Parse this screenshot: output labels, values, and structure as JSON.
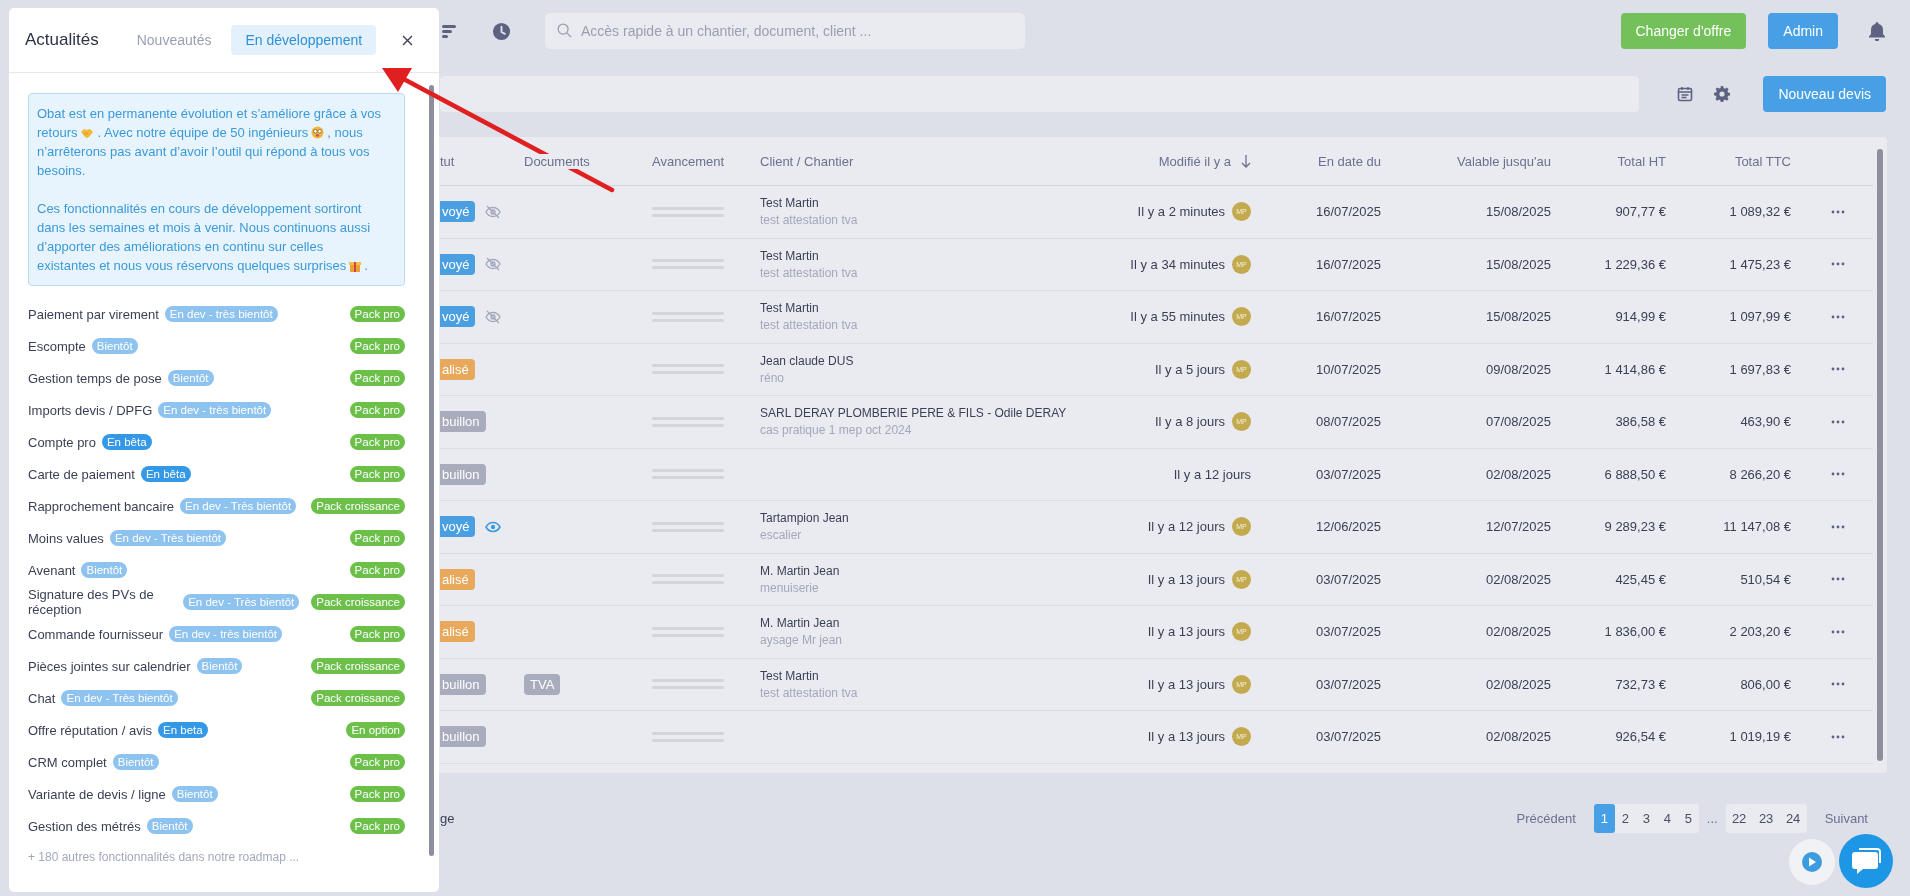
{
  "topbar": {
    "search": {
      "placeholder": "Accès rapide à un chantier, document, client ..."
    },
    "buttons": [
      {
        "label": "Changer d'offre",
        "kind": "upgrade"
      },
      {
        "label": "Admin",
        "kind": "primary"
      }
    ]
  },
  "toolbar": {
    "new_button": "Nouveau devis"
  },
  "table": {
    "columns": [
      "tut",
      "Documents",
      "Avancement",
      "Client / Chantier",
      "Modifié il y a",
      "En date du",
      "Valable jusqu'au",
      "Total HT",
      "Total TTC"
    ],
    "rows": [
      {
        "status": "voyé",
        "kind": "sent",
        "seen": false,
        "client": "Test Martin",
        "site": "test attestation tva",
        "modified": "Il y a 2 minutes",
        "avatar": "MP",
        "date": "16/07/2025",
        "valid_until": "15/08/2025",
        "total_ht": "907,77 €",
        "total_ttc": "1 089,32 €"
      },
      {
        "status": "voyé",
        "kind": "sent",
        "seen": false,
        "client": "Test Martin",
        "site": "test attestation tva",
        "modified": "Il y a 34 minutes",
        "avatar": "MP",
        "date": "16/07/2025",
        "valid_until": "15/08/2025",
        "total_ht": "1 229,36 €",
        "total_ttc": "1 475,23 €"
      },
      {
        "status": "voyé",
        "kind": "sent",
        "seen": false,
        "client": "Test Martin",
        "site": "test attestation tva",
        "modified": "Il y a 55 minutes",
        "avatar": "MP",
        "date": "16/07/2025",
        "valid_until": "15/08/2025",
        "total_ht": "914,99 €",
        "total_ttc": "1 097,99 €"
      },
      {
        "status": "alisé",
        "kind": "finalised",
        "client": "Jean claude DUS",
        "site": "réno",
        "modified": "Il y a 5 jours",
        "avatar": "MP",
        "date": "10/07/2025",
        "valid_until": "09/08/2025",
        "total_ht": "1 414,86 €",
        "total_ttc": "1 697,83 €"
      },
      {
        "status": "buillon",
        "kind": "draft",
        "client": "SARL DERAY PLOMBERIE PERE & FILS - Odile DERAY",
        "site": "cas pratique 1 mep oct 2024",
        "modified": "Il y a 8 jours",
        "avatar": "MP",
        "date": "08/07/2025",
        "valid_until": "07/08/2025",
        "total_ht": "386,58 €",
        "total_ttc": "463,90 €"
      },
      {
        "status": "buillon",
        "kind": "draft",
        "modified": "Il y a 12 jours",
        "date": "03/07/2025",
        "valid_until": "02/08/2025",
        "total_ht": "6 888,50 €",
        "total_ttc": "8 266,20 €"
      },
      {
        "status": "voyé",
        "kind": "sent",
        "seen": true,
        "client": "Tartampion Jean",
        "site": "escalier",
        "modified": "Il y a 12 jours",
        "avatar": "MP",
        "date": "12/06/2025",
        "valid_until": "12/07/2025",
        "total_ht": "9 289,23 €",
        "total_ttc": "11 147,08 €"
      },
      {
        "status": "alisé",
        "kind": "finalised",
        "client": "M. Martin Jean",
        "site": "menuiserie",
        "modified": "Il y a 13 jours",
        "avatar": "MP",
        "date": "03/07/2025",
        "valid_until": "02/08/2025",
        "total_ht": "425,45 €",
        "total_ttc": "510,54 €"
      },
      {
        "status": "alisé",
        "kind": "finalised",
        "client": "M. Martin Jean",
        "site": "aysage Mr jean",
        "modified": "Il y a 13 jours",
        "avatar": "MP",
        "date": "03/07/2025",
        "valid_until": "02/08/2025",
        "total_ht": "1 836,00 €",
        "total_ttc": "2 203,20 €"
      },
      {
        "status": "buillon",
        "kind": "draft",
        "document": "TVA",
        "client": "Test Martin",
        "site": "test attestation tva",
        "modified": "Il y a 13 jours",
        "avatar": "MP",
        "date": "03/07/2025",
        "valid_until": "02/08/2025",
        "total_ht": "732,73 €",
        "total_ttc": "806,00 €"
      },
      {
        "status": "buillon",
        "kind": "draft",
        "modified": "Il y a 13 jours",
        "avatar": "MP",
        "date": "03/07/2025",
        "valid_until": "02/08/2025",
        "total_ht": "926,54 €",
        "total_ttc": "1 019,19 €"
      }
    ]
  },
  "pagination": {
    "cut_text": "ge",
    "previous": "Précédent",
    "pages": [
      {
        "label": "1",
        "selected": true
      },
      {
        "label": "2",
        "selected": false
      },
      {
        "label": "3",
        "selected": false
      },
      {
        "label": "4",
        "selected": false
      },
      {
        "label": "5",
        "selected": false
      }
    ],
    "ellipsis": "...",
    "last_pages": [
      {
        "label": "22",
        "selected": false
      },
      {
        "label": "23",
        "selected": false
      },
      {
        "label": "24",
        "selected": false
      }
    ],
    "next": "Suivant"
  },
  "news_panel": {
    "title": "Actualités",
    "tabs": [
      {
        "label": "Nouveautés",
        "selected": false
      },
      {
        "label": "En développement",
        "selected": true
      }
    ],
    "intro": [
      [
        [
          "Obat est en permanente évolution et s’améliore grâce à vos"
        ],
        [
          "retours",
          ". Avec notre équipe de 50 ingénieurs",
          ", nous"
        ],
        [
          "n’arrêterons pas avant d’avoir l’outil qui répond à tous vos"
        ],
        [
          "besoins."
        ]
      ],
      [
        [
          "Ces fonctionnalités en cours de développement sortiront"
        ],
        [
          "dans les semaines et mois à venir. Nous continuons aussi"
        ],
        [
          "d’apporter des améliorations en continu sur celles"
        ],
        [
          "existantes et nous vous réservons quelques surprises",
          "."
        ]
      ]
    ],
    "features": [
      {
        "name": "Paiement par virement",
        "tag": "En dev - très bientôt",
        "kind": "soon",
        "pack": "Pack pro"
      },
      {
        "name": "Escompte",
        "tag": "Bientôt",
        "kind": "soon",
        "pack": "Pack pro"
      },
      {
        "name": "Gestion temps de pose",
        "tag": "Bientôt",
        "kind": "soon",
        "pack": "Pack pro"
      },
      {
        "name": "Imports devis / DPFG",
        "tag": "En dev - très bientôt",
        "kind": "soon",
        "pack": "Pack pro"
      },
      {
        "name": "Compte pro",
        "tag": "En bêta",
        "kind": "beta",
        "pack": "Pack pro"
      },
      {
        "name": "Carte de paiement",
        "tag": "En bêta",
        "kind": "beta",
        "pack": "Pack pro"
      },
      {
        "name": "Rapprochement bancaire",
        "tag": "En dev - Très bientôt",
        "kind": "soon",
        "pack": "Pack croissance"
      },
      {
        "name": "Moins values",
        "tag": "En dev - Très bientôt",
        "kind": "soon",
        "pack": "Pack pro"
      },
      {
        "name": "Avenant",
        "tag": "Bientôt",
        "kind": "soon",
        "pack": "Pack pro"
      },
      {
        "name": "Signature des PVs de réception",
        "tag": "En dev - Très bientôt",
        "kind": "soon",
        "pack": "Pack croissance"
      },
      {
        "name": "Commande fournisseur",
        "tag": "En dev - très bientôt",
        "kind": "soon",
        "pack": "Pack pro"
      },
      {
        "name": "Pièces jointes sur calendrier",
        "tag": "Bientôt",
        "kind": "soon",
        "pack": "Pack croissance"
      },
      {
        "name": "Chat",
        "tag": "En dev - Très bientôt",
        "kind": "soon",
        "pack": "Pack croissance"
      },
      {
        "name": "Offre réputation / avis",
        "tag": "En beta",
        "kind": "beta",
        "pack": "En option"
      },
      {
        "name": "CRM complet",
        "tag": "Bientôt",
        "kind": "soon",
        "pack": "Pack pro"
      },
      {
        "name": "Variante de devis / ligne",
        "tag": "Bientôt",
        "kind": "soon",
        "pack": "Pack pro"
      },
      {
        "name": "Gestion des métrés",
        "tag": "Bientôt",
        "kind": "soon",
        "pack": "Pack pro"
      }
    ],
    "footer": "+ 180 autres fonctionnalités dans notre roadmap ..."
  }
}
